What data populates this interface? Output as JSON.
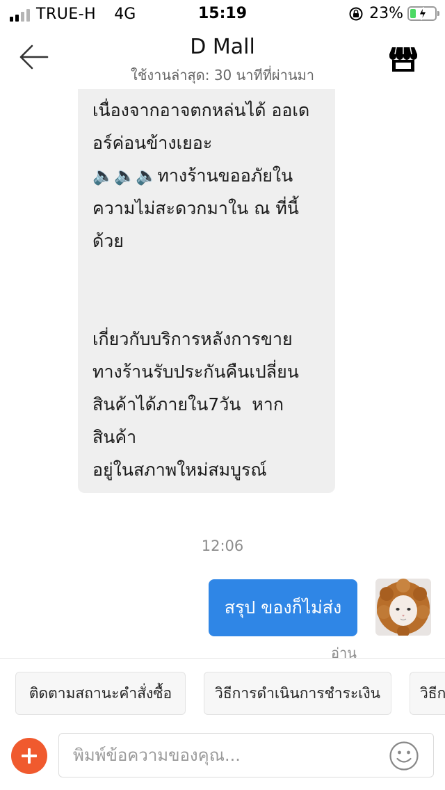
{
  "status_bar": {
    "carrier": "TRUE-H",
    "network": "4G",
    "time": "15:19",
    "battery_percent": "23%",
    "battery_level": 0.23,
    "signal_bars": 2
  },
  "header": {
    "title": "D Mall",
    "subtitle": "ใช้งานล่าสุด: 30 นาทีที่ผ่านมา",
    "back_icon": "arrow-left-icon",
    "shop_icon": "storefront-icon"
  },
  "messages": {
    "incoming": "ทางร้านได้ทันทีเลยค่ะ\nเนื่องจากอาจตกหล่นได้ ออเด\nอร์ค่อนข้างเยอะ\n🔈🔈🔈ทางร้านขออภัยใน\nความไม่สะดวกมาใน ณ ที่นี้\nด้วย\n\n\nเกี่ยวกับบริการหลังการขาย\nทางร้านรับประกันคืนเปลี่ยน\nสินค้าได้ภายใน7วัน  หากสินค้า\nอยู่ในสภาพใหม่สมบูรณ์",
    "timestamp": "12:06",
    "outgoing": "สรุป ของก็ไม่ส่ง",
    "read_status": "อ่าน"
  },
  "quick_replies": [
    "ติดตามสถานะคำสั่งซื้อ",
    "วิธีการดำเนินการชำระเงิน",
    "วิธีก"
  ],
  "input": {
    "placeholder": "พิมพ์ข้อความของคุณ..."
  },
  "colors": {
    "sent_bubble": "#2f86e6",
    "received_bubble": "#efefef",
    "add_button": "#f05a2e",
    "battery_fill": "#4cd964"
  }
}
